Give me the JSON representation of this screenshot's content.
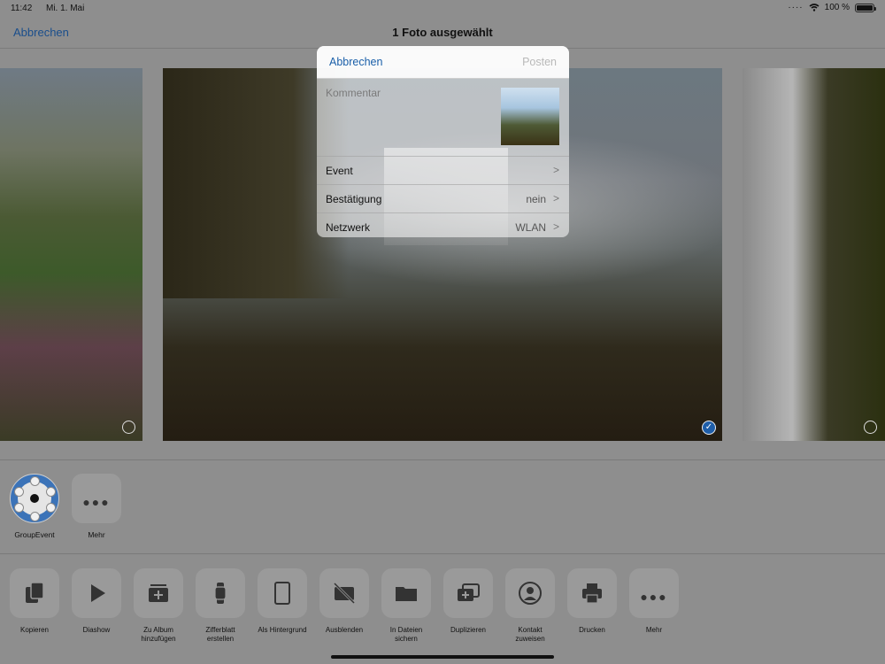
{
  "status": {
    "time": "11:42",
    "date": "Mi. 1. Mai",
    "battery": "100 %"
  },
  "header": {
    "cancel": "Abbrechen",
    "title": "1 Foto ausgewählt"
  },
  "dialog": {
    "cancel": "Abbrechen",
    "post": "Posten",
    "comment_placeholder": "Kommentar",
    "rows": [
      {
        "label": "Event",
        "value": ""
      },
      {
        "label": "Bestätigung",
        "value": "nein"
      },
      {
        "label": "Netzwerk",
        "value": "WLAN"
      }
    ]
  },
  "apps": [
    {
      "label": "GroupEvent"
    },
    {
      "label": "Mehr"
    }
  ],
  "actions": [
    {
      "label": "Kopieren",
      "icon": "copy-icon"
    },
    {
      "label": "Diashow",
      "icon": "play-icon"
    },
    {
      "label": "Zu Album\nhinzufügen",
      "icon": "add-album-icon"
    },
    {
      "label": "Zifferblatt\nerstellen",
      "icon": "watch-icon"
    },
    {
      "label": "Als Hintergrund",
      "icon": "wallpaper-icon"
    },
    {
      "label": "Ausblenden",
      "icon": "hide-icon"
    },
    {
      "label": "In Dateien\nsichern",
      "icon": "folder-icon"
    },
    {
      "label": "Duplizieren",
      "icon": "duplicate-icon"
    },
    {
      "label": "Kontakt\nzuweisen",
      "icon": "contact-icon"
    },
    {
      "label": "Drucken",
      "icon": "print-icon"
    },
    {
      "label": "Mehr",
      "icon": "more-icon"
    }
  ]
}
